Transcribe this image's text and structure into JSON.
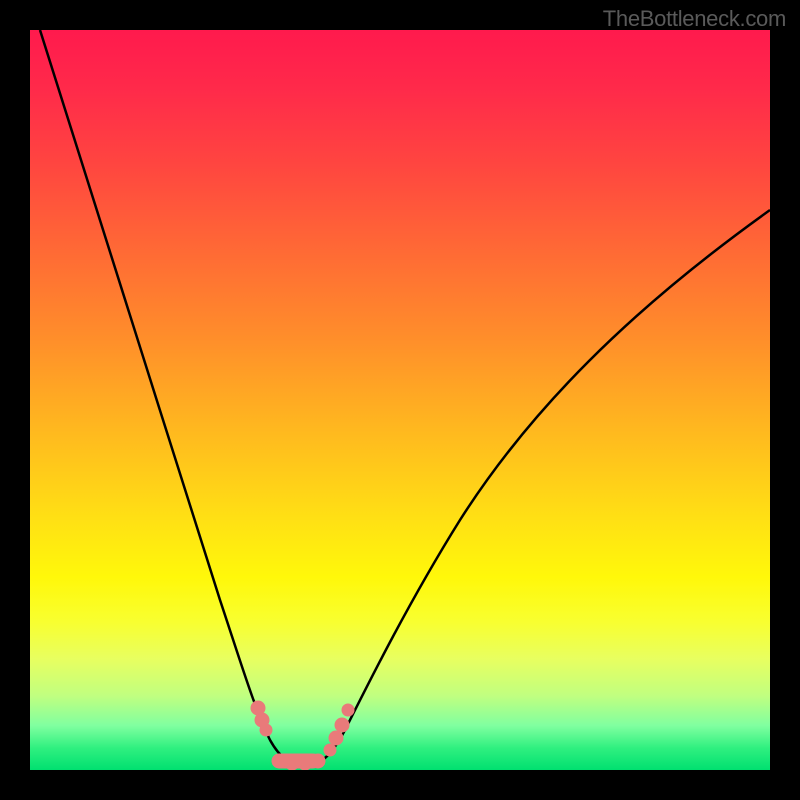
{
  "watermark": "TheBottleneck.com",
  "chart_data": {
    "type": "line",
    "title": "",
    "xlabel": "",
    "ylabel": "",
    "xlim": [
      0,
      100
    ],
    "ylim": [
      0,
      100
    ],
    "series": [
      {
        "name": "bottleneck-curve",
        "x": [
          0,
          5,
          10,
          15,
          20,
          25,
          28,
          30,
          32,
          34,
          36,
          38,
          40,
          45,
          50,
          55,
          60,
          65,
          70,
          75,
          80,
          85,
          90,
          95,
          100
        ],
        "y": [
          100,
          87,
          74,
          61,
          48,
          33,
          22,
          14,
          7,
          3,
          1,
          1,
          2,
          6,
          12,
          19,
          26,
          33,
          40,
          46,
          52,
          57,
          62,
          66,
          70
        ]
      }
    ],
    "marker_region": {
      "name": "optimal-range-markers",
      "x": [
        27,
        28,
        30,
        32,
        34,
        36,
        37,
        38,
        39,
        40
      ],
      "y": [
        24,
        20,
        3,
        2,
        2,
        2,
        3,
        4,
        10,
        16
      ],
      "color": "#e97a7a"
    },
    "gradient_stops": [
      {
        "pos": 0,
        "color": "#ff1a4d"
      },
      {
        "pos": 50,
        "color": "#ffd020"
      },
      {
        "pos": 80,
        "color": "#f5ff40"
      },
      {
        "pos": 100,
        "color": "#00e070"
      }
    ]
  }
}
